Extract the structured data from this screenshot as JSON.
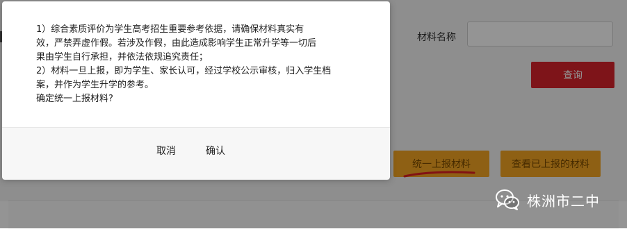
{
  "search": {
    "label": "材料名称",
    "input_value": "",
    "query_label": "查询"
  },
  "actions": {
    "report_label": "统一上报材料",
    "view_label": "查看已上报的材料"
  },
  "dialog": {
    "lines": [
      "1）综合素质评价为学生高考招生重要参考依据，请确保材料真实有",
      "效，严禁弄虚作假。若涉及作假，由此造成影响学生正常升学等一切后",
      "果由学生自行承担，并依法依规追究责任；",
      "2）材料一旦上报，即为学生、家长认可，经过学校公示审核，归入学生档",
      "案，并作为学生升学的参考。",
      "确定统一上报材料?"
    ],
    "cancel_label": "取消",
    "confirm_label": "确认"
  },
  "watermark": {
    "text": "株洲市二中",
    "icon": "wechat-icon"
  },
  "colors": {
    "query_button": "#d9232b",
    "action_button": "#f5a623",
    "underline_annotation": "#e02020"
  }
}
